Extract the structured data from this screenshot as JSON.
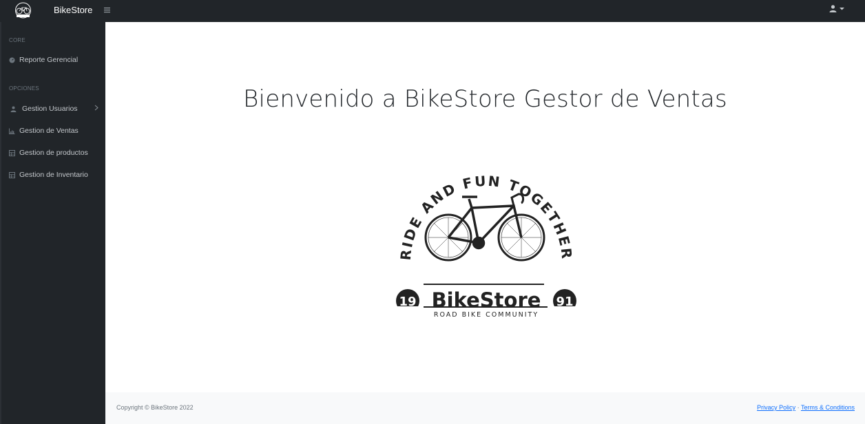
{
  "topbar": {
    "brand_name": "BikeStore",
    "toggle_icon": "hamburger-icon",
    "user_icon": "user-icon"
  },
  "sidebar": {
    "headings": [
      "CORE",
      "OPCIONES"
    ],
    "items": [
      {
        "label": "Reporte Gerencial",
        "icon": "dashboard-icon"
      },
      {
        "label": "Gestion Usuarios",
        "icon": "user-icon"
      },
      {
        "label": "Gestion de Ventas",
        "icon": "chart-icon"
      },
      {
        "label": "Gestion de productos",
        "icon": "table-icon"
      },
      {
        "label": "Gestion de Inventario",
        "icon": "table-icon"
      }
    ]
  },
  "main": {
    "title": "Bienvenido a BikeStore Gestor de Ventas",
    "logo": {
      "arc_text": "RIDE AND FUN TOGETHER",
      "year_left": "19",
      "year_right": "91",
      "name": "BikeStore",
      "tagline": "ROAD BIKE COMMUNITY"
    }
  },
  "footer": {
    "copyright": "Copyright © BikeStore 2022",
    "privacy": "Privacy Policy",
    "separator": "·",
    "terms": "Terms & Conditions"
  },
  "colors": {
    "sidebar_bg": "#212529",
    "link": "#0d6efd",
    "footer_bg": "#f8f9fa"
  }
}
